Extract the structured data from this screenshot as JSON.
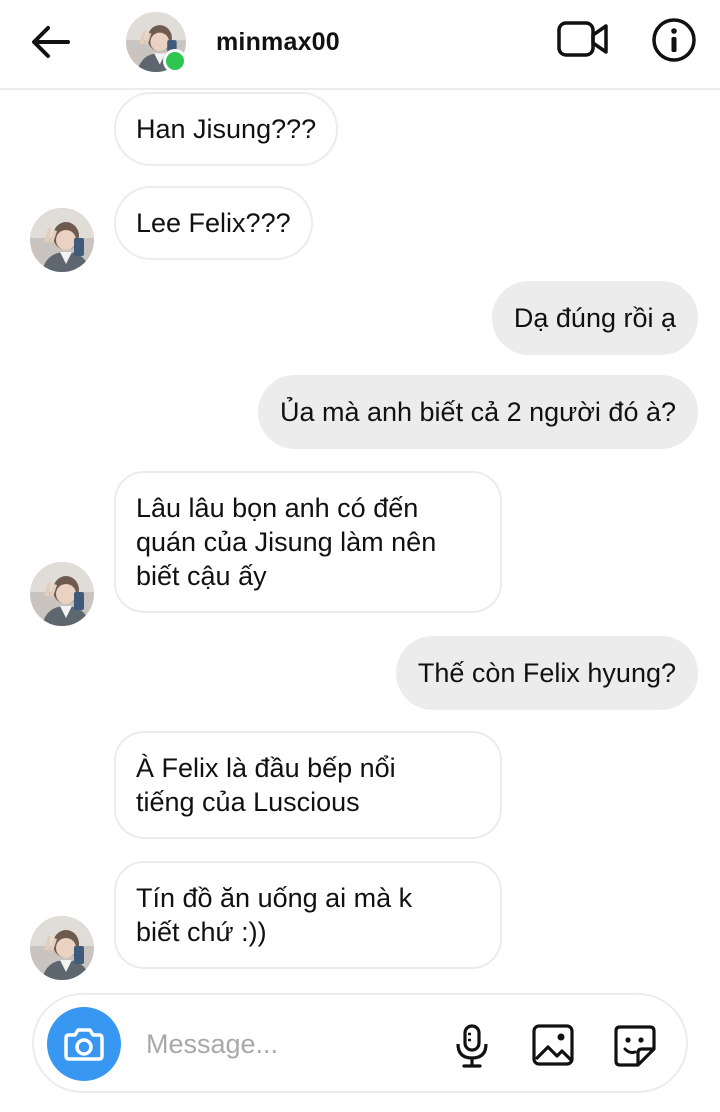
{
  "header": {
    "username": "minmax00",
    "online": true
  },
  "messages": [
    {
      "side": "in",
      "text": "Han Jisung???"
    },
    {
      "side": "in",
      "text": "Lee Felix???"
    },
    {
      "side": "out",
      "text": "Dạ đúng rồi ạ"
    },
    {
      "side": "out",
      "text": "Ủa mà anh biết  cả 2 người đó à?"
    },
    {
      "side": "in",
      "lines": [
        "Lâu lâu bọn anh có đến",
        "quán của Jisung làm nên",
        "biết cậu ấy"
      ]
    },
    {
      "side": "out",
      "text": "Thế còn Felix hyung?"
    },
    {
      "side": "in",
      "lines": [
        "À Felix là đầu bếp nổi",
        "tiếng của Luscious"
      ]
    },
    {
      "side": "in",
      "lines": [
        "Tín đồ ăn uống ai mà k",
        "biết chứ :))"
      ]
    }
  ],
  "composer": {
    "placeholder": "Message..."
  },
  "icons": {
    "back": "arrow-left-icon",
    "video": "video-camera-icon",
    "info": "info-icon",
    "camera": "camera-icon",
    "mic": "microphone-icon",
    "gallery": "image-icon",
    "sticker": "sticker-icon"
  },
  "colors": {
    "accent": "#3897f0",
    "online": "#2ec651",
    "outgoing_bubble": "#ececec",
    "border": "#ececec"
  }
}
